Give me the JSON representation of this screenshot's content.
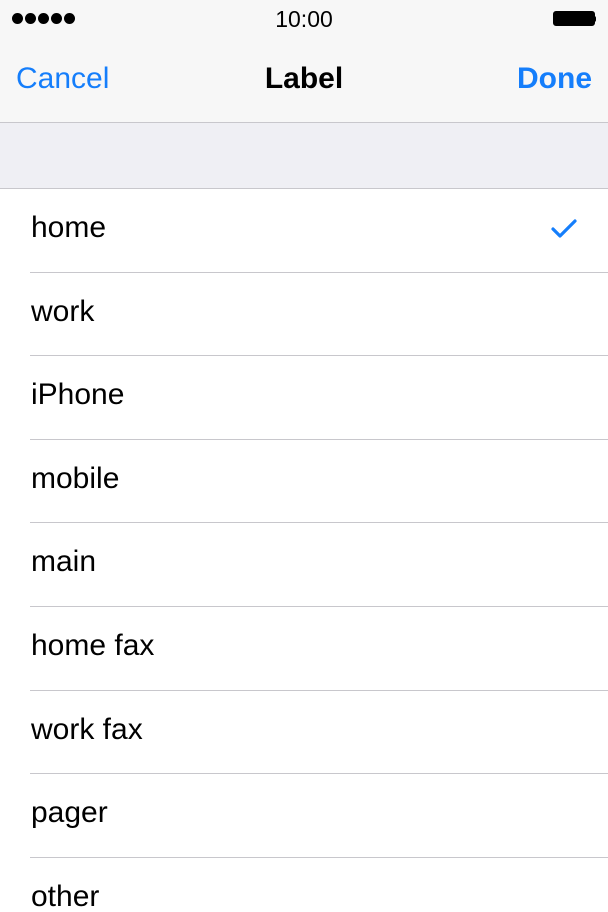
{
  "status_bar": {
    "time": "10:00",
    "signal_bars": 5,
    "battery_level": 1.0
  },
  "navbar": {
    "cancel_label": "Cancel",
    "title": "Label",
    "done_label": "Done"
  },
  "labels": {
    "items": [
      {
        "label": "home",
        "selected": true
      },
      {
        "label": "work",
        "selected": false
      },
      {
        "label": "iPhone",
        "selected": false
      },
      {
        "label": "mobile",
        "selected": false
      },
      {
        "label": "main",
        "selected": false
      },
      {
        "label": "home fax",
        "selected": false
      },
      {
        "label": "work fax",
        "selected": false
      },
      {
        "label": "pager",
        "selected": false
      },
      {
        "label": "other",
        "selected": false
      }
    ]
  },
  "colors": {
    "accent": "#157efb",
    "bar_background": "#f7f7f7",
    "group_background": "#efeff4",
    "separator": "#c8c7cc"
  },
  "icons": {
    "signal": "signal-dots-icon",
    "battery": "battery-icon",
    "selected": "checkmark-icon"
  }
}
